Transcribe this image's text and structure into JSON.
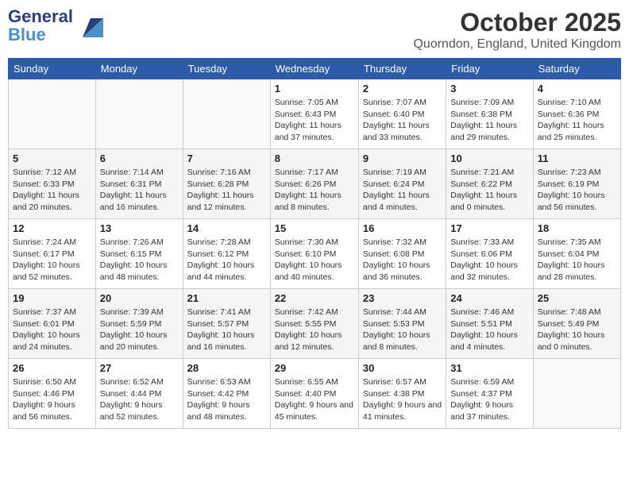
{
  "header": {
    "logo_general": "General",
    "logo_blue": "Blue",
    "month": "October 2025",
    "location": "Quorndon, England, United Kingdom"
  },
  "weekdays": [
    "Sunday",
    "Monday",
    "Tuesday",
    "Wednesday",
    "Thursday",
    "Friday",
    "Saturday"
  ],
  "weeks": [
    [
      {
        "day": "",
        "empty": true
      },
      {
        "day": "",
        "empty": true
      },
      {
        "day": "",
        "empty": true
      },
      {
        "day": "1",
        "sunrise": "Sunrise: 7:05 AM",
        "sunset": "Sunset: 6:43 PM",
        "daylight": "Daylight: 11 hours and 37 minutes."
      },
      {
        "day": "2",
        "sunrise": "Sunrise: 7:07 AM",
        "sunset": "Sunset: 6:40 PM",
        "daylight": "Daylight: 11 hours and 33 minutes."
      },
      {
        "day": "3",
        "sunrise": "Sunrise: 7:09 AM",
        "sunset": "Sunset: 6:38 PM",
        "daylight": "Daylight: 11 hours and 29 minutes."
      },
      {
        "day": "4",
        "sunrise": "Sunrise: 7:10 AM",
        "sunset": "Sunset: 6:36 PM",
        "daylight": "Daylight: 11 hours and 25 minutes."
      }
    ],
    [
      {
        "day": "5",
        "sunrise": "Sunrise: 7:12 AM",
        "sunset": "Sunset: 6:33 PM",
        "daylight": "Daylight: 11 hours and 20 minutes."
      },
      {
        "day": "6",
        "sunrise": "Sunrise: 7:14 AM",
        "sunset": "Sunset: 6:31 PM",
        "daylight": "Daylight: 11 hours and 16 minutes."
      },
      {
        "day": "7",
        "sunrise": "Sunrise: 7:16 AM",
        "sunset": "Sunset: 6:28 PM",
        "daylight": "Daylight: 11 hours and 12 minutes."
      },
      {
        "day": "8",
        "sunrise": "Sunrise: 7:17 AM",
        "sunset": "Sunset: 6:26 PM",
        "daylight": "Daylight: 11 hours and 8 minutes."
      },
      {
        "day": "9",
        "sunrise": "Sunrise: 7:19 AM",
        "sunset": "Sunset: 6:24 PM",
        "daylight": "Daylight: 11 hours and 4 minutes."
      },
      {
        "day": "10",
        "sunrise": "Sunrise: 7:21 AM",
        "sunset": "Sunset: 6:22 PM",
        "daylight": "Daylight: 11 hours and 0 minutes."
      },
      {
        "day": "11",
        "sunrise": "Sunrise: 7:23 AM",
        "sunset": "Sunset: 6:19 PM",
        "daylight": "Daylight: 10 hours and 56 minutes."
      }
    ],
    [
      {
        "day": "12",
        "sunrise": "Sunrise: 7:24 AM",
        "sunset": "Sunset: 6:17 PM",
        "daylight": "Daylight: 10 hours and 52 minutes."
      },
      {
        "day": "13",
        "sunrise": "Sunrise: 7:26 AM",
        "sunset": "Sunset: 6:15 PM",
        "daylight": "Daylight: 10 hours and 48 minutes."
      },
      {
        "day": "14",
        "sunrise": "Sunrise: 7:28 AM",
        "sunset": "Sunset: 6:12 PM",
        "daylight": "Daylight: 10 hours and 44 minutes."
      },
      {
        "day": "15",
        "sunrise": "Sunrise: 7:30 AM",
        "sunset": "Sunset: 6:10 PM",
        "daylight": "Daylight: 10 hours and 40 minutes."
      },
      {
        "day": "16",
        "sunrise": "Sunrise: 7:32 AM",
        "sunset": "Sunset: 6:08 PM",
        "daylight": "Daylight: 10 hours and 36 minutes."
      },
      {
        "day": "17",
        "sunrise": "Sunrise: 7:33 AM",
        "sunset": "Sunset: 6:06 PM",
        "daylight": "Daylight: 10 hours and 32 minutes."
      },
      {
        "day": "18",
        "sunrise": "Sunrise: 7:35 AM",
        "sunset": "Sunset: 6:04 PM",
        "daylight": "Daylight: 10 hours and 28 minutes."
      }
    ],
    [
      {
        "day": "19",
        "sunrise": "Sunrise: 7:37 AM",
        "sunset": "Sunset: 6:01 PM",
        "daylight": "Daylight: 10 hours and 24 minutes."
      },
      {
        "day": "20",
        "sunrise": "Sunrise: 7:39 AM",
        "sunset": "Sunset: 5:59 PM",
        "daylight": "Daylight: 10 hours and 20 minutes."
      },
      {
        "day": "21",
        "sunrise": "Sunrise: 7:41 AM",
        "sunset": "Sunset: 5:57 PM",
        "daylight": "Daylight: 10 hours and 16 minutes."
      },
      {
        "day": "22",
        "sunrise": "Sunrise: 7:42 AM",
        "sunset": "Sunset: 5:55 PM",
        "daylight": "Daylight: 10 hours and 12 minutes."
      },
      {
        "day": "23",
        "sunrise": "Sunrise: 7:44 AM",
        "sunset": "Sunset: 5:53 PM",
        "daylight": "Daylight: 10 hours and 8 minutes."
      },
      {
        "day": "24",
        "sunrise": "Sunrise: 7:46 AM",
        "sunset": "Sunset: 5:51 PM",
        "daylight": "Daylight: 10 hours and 4 minutes."
      },
      {
        "day": "25",
        "sunrise": "Sunrise: 7:48 AM",
        "sunset": "Sunset: 5:49 PM",
        "daylight": "Daylight: 10 hours and 0 minutes."
      }
    ],
    [
      {
        "day": "26",
        "sunrise": "Sunrise: 6:50 AM",
        "sunset": "Sunset: 4:46 PM",
        "daylight": "Daylight: 9 hours and 56 minutes."
      },
      {
        "day": "27",
        "sunrise": "Sunrise: 6:52 AM",
        "sunset": "Sunset: 4:44 PM",
        "daylight": "Daylight: 9 hours and 52 minutes."
      },
      {
        "day": "28",
        "sunrise": "Sunrise: 6:53 AM",
        "sunset": "Sunset: 4:42 PM",
        "daylight": "Daylight: 9 hours and 48 minutes."
      },
      {
        "day": "29",
        "sunrise": "Sunrise: 6:55 AM",
        "sunset": "Sunset: 4:40 PM",
        "daylight": "Daylight: 9 hours and 45 minutes."
      },
      {
        "day": "30",
        "sunrise": "Sunrise: 6:57 AM",
        "sunset": "Sunset: 4:38 PM",
        "daylight": "Daylight: 9 hours and 41 minutes."
      },
      {
        "day": "31",
        "sunrise": "Sunrise: 6:59 AM",
        "sunset": "Sunset: 4:37 PM",
        "daylight": "Daylight: 9 hours and 37 minutes."
      },
      {
        "day": "",
        "empty": true
      }
    ]
  ]
}
